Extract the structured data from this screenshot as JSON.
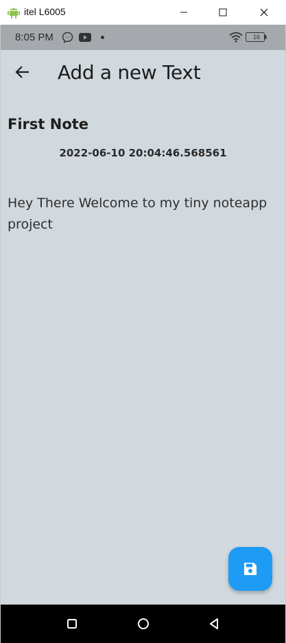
{
  "window": {
    "title": "itel L6005"
  },
  "status_bar": {
    "time": "8:05 PM",
    "battery": "16"
  },
  "app_bar": {
    "title": "Add a new Text"
  },
  "note": {
    "title": "First Note",
    "date": "2022-06-10 20:04:46.568561",
    "body": "Hey There Welcome to my tiny noteapp project"
  },
  "colors": {
    "background": "#d2d9de",
    "fab": "#1e9bf5",
    "android_green": "#8bc34a"
  }
}
